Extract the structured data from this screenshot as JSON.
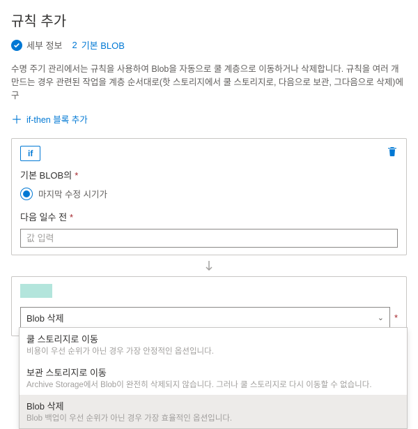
{
  "header": {
    "title": "규칙 추가",
    "steps": {
      "step1": {
        "label": "세부 정보"
      },
      "step2": {
        "label": "기본 BLOB",
        "number": "2"
      }
    }
  },
  "description": "수명 주기 관리에서는 규칙을 사용하여 Blob을 자동으로 쿨 계층으로 이동하거나 삭제합니다. 규칙을 여러 개 만드는 경우 관련된 작업을 계층 순서대로(핫 스토리지에서 쿨 스토리지로, 다음으로 보관, 그다음으로 삭제)에 구",
  "addBlock": {
    "label": "if-then 블록 추가"
  },
  "ifCard": {
    "badge": "if",
    "field1": {
      "label": "기본 BLOB의"
    },
    "radio": {
      "label": "마지막 수정 시기가"
    },
    "field2": {
      "label": "다음 일수 전",
      "placeholder": "값 입력"
    }
  },
  "thenCard": {
    "badge": " ",
    "dropdown": {
      "selected": "Blob 삭제"
    },
    "options": [
      {
        "title": "쿨 스토리지로 이동",
        "desc": "비용이 우선 순위가 아닌 경우 가장 안정적인 옵션입니다."
      },
      {
        "title": "보관 스토리지로 이동",
        "desc": "Archive Storage에서 Blob이 완전히 삭제되지 않습니다. 그러나 쿨 스토리지로 다시 이동할 수 없습니다."
      },
      {
        "title": "Blob 삭제",
        "desc": "Blob 백업이 우선 순위가 아닌 경우 가장 효율적인 옵션입니다."
      }
    ]
  }
}
